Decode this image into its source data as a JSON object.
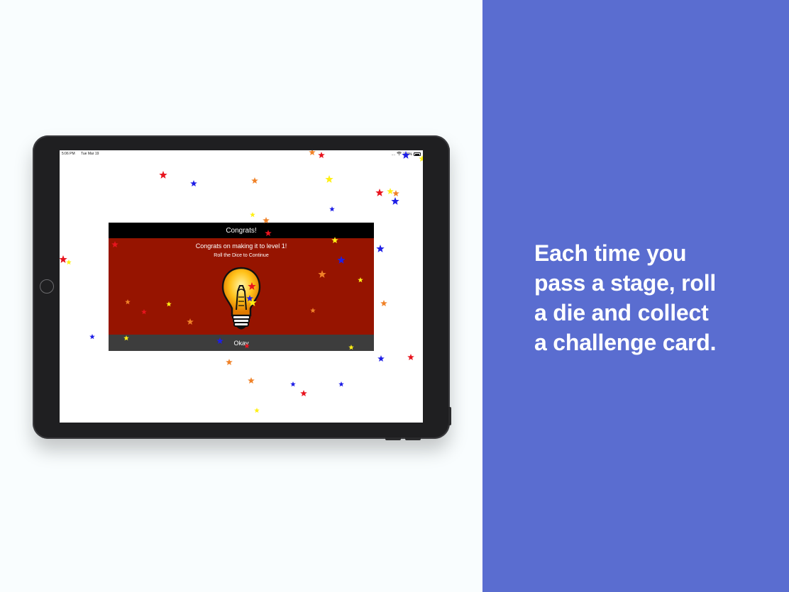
{
  "caption": {
    "lines": [
      "Each time you",
      "pass a stage, roll",
      "a die and collect",
      "a challenge card."
    ]
  },
  "status_bar": {
    "time": "5:06 PM",
    "date": "Tue Mar 19",
    "signal": "....",
    "battery": "100%",
    "icons": [
      "wifi-icon",
      "battery-icon"
    ]
  },
  "dialog": {
    "title": "Congrats!",
    "message": "Congrats on making it to level 1!",
    "subtitle": "Roll the Dice to Continue",
    "button_label": "Okay",
    "icon": "lightbulb-icon"
  },
  "colors": {
    "right_panel": "#5a6dd0",
    "dialog_body": "#961400",
    "dialog_header": "#000000",
    "dialog_footer": "#3d3d3d",
    "star_red": "#e8141e",
    "star_blue": "#1e1ee6",
    "star_orange": "#f08228",
    "star_yellow": "#fff014"
  },
  "confetti_icon": "star-icon"
}
